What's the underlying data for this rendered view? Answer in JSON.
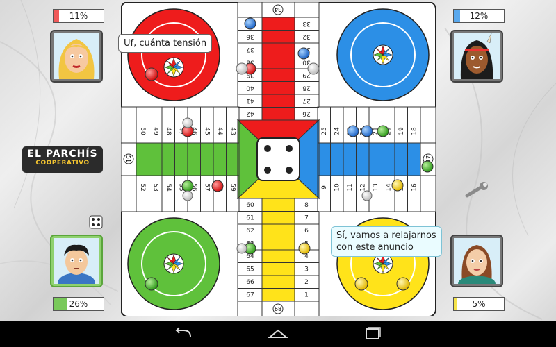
{
  "game": {
    "logo_line1": "EL PARCHÍS",
    "logo_line2": "COOPERATIVO"
  },
  "players": {
    "red": {
      "avatar": "blonde-woman-avatar",
      "progress_label": "11%",
      "progress": 0.11,
      "bar_color": "#f05a5a"
    },
    "blue": {
      "avatar": "native-man-avatar",
      "progress_label": "12%",
      "progress": 0.12,
      "bar_color": "#5aa9ee"
    },
    "green": {
      "avatar": "man-avatar",
      "progress_label": "26%",
      "progress": 0.26,
      "bar_color": "#79c95a",
      "active": true
    },
    "yellow": {
      "avatar": "woman-avatar",
      "progress_label": "5%",
      "progress": 0.05,
      "bar_color": "#f4e34a"
    }
  },
  "bubbles": {
    "red_speech": "Uf, cuánta tensión",
    "yellow_speech_line1": "Sí, vamos a relajarnos",
    "yellow_speech_line2": "con este anuncio"
  },
  "board_numbers": {
    "top_left_col": [
      "35",
      "36",
      "37",
      "38",
      "39",
      "40",
      "41",
      "42"
    ],
    "top_right_col": [
      "33",
      "32",
      "31",
      "30",
      "29",
      "28",
      "27",
      "26"
    ],
    "top_safe": "34",
    "left_top_row": [
      "50",
      "49",
      "48",
      "47",
      "46",
      "45",
      "44",
      "43"
    ],
    "left_bottom_row": [
      "52",
      "53",
      "54",
      "55",
      "56",
      "57",
      "58",
      "59"
    ],
    "left_safe": "51",
    "right_top_row": [
      "25",
      "24",
      "23",
      "22",
      "21",
      "20",
      "19",
      "18"
    ],
    "right_bottom_row": [
      "9",
      "10",
      "11",
      "12",
      "13",
      "14",
      "15",
      "16"
    ],
    "right_safe": "17",
    "bottom_left_col": [
      "60",
      "61",
      "62",
      "63",
      "64",
      "65",
      "66",
      "67"
    ],
    "bottom_right_col": [
      "8",
      "7",
      "6",
      "5",
      "4",
      "3",
      "2",
      "1"
    ],
    "bottom_safe": "68"
  },
  "dice": {
    "value": 4,
    "small_die_value": 4
  },
  "colors": {
    "red": "#ee1c1c",
    "blue": "#2c8fe6",
    "green": "#5fc13b",
    "yellow": "#ffe31a",
    "board_bg": "#ffffff"
  },
  "icons": {
    "settings": "wrench-icon",
    "nav_back": "back-icon",
    "nav_home": "home-icon",
    "nav_recent": "recent-apps-icon"
  }
}
